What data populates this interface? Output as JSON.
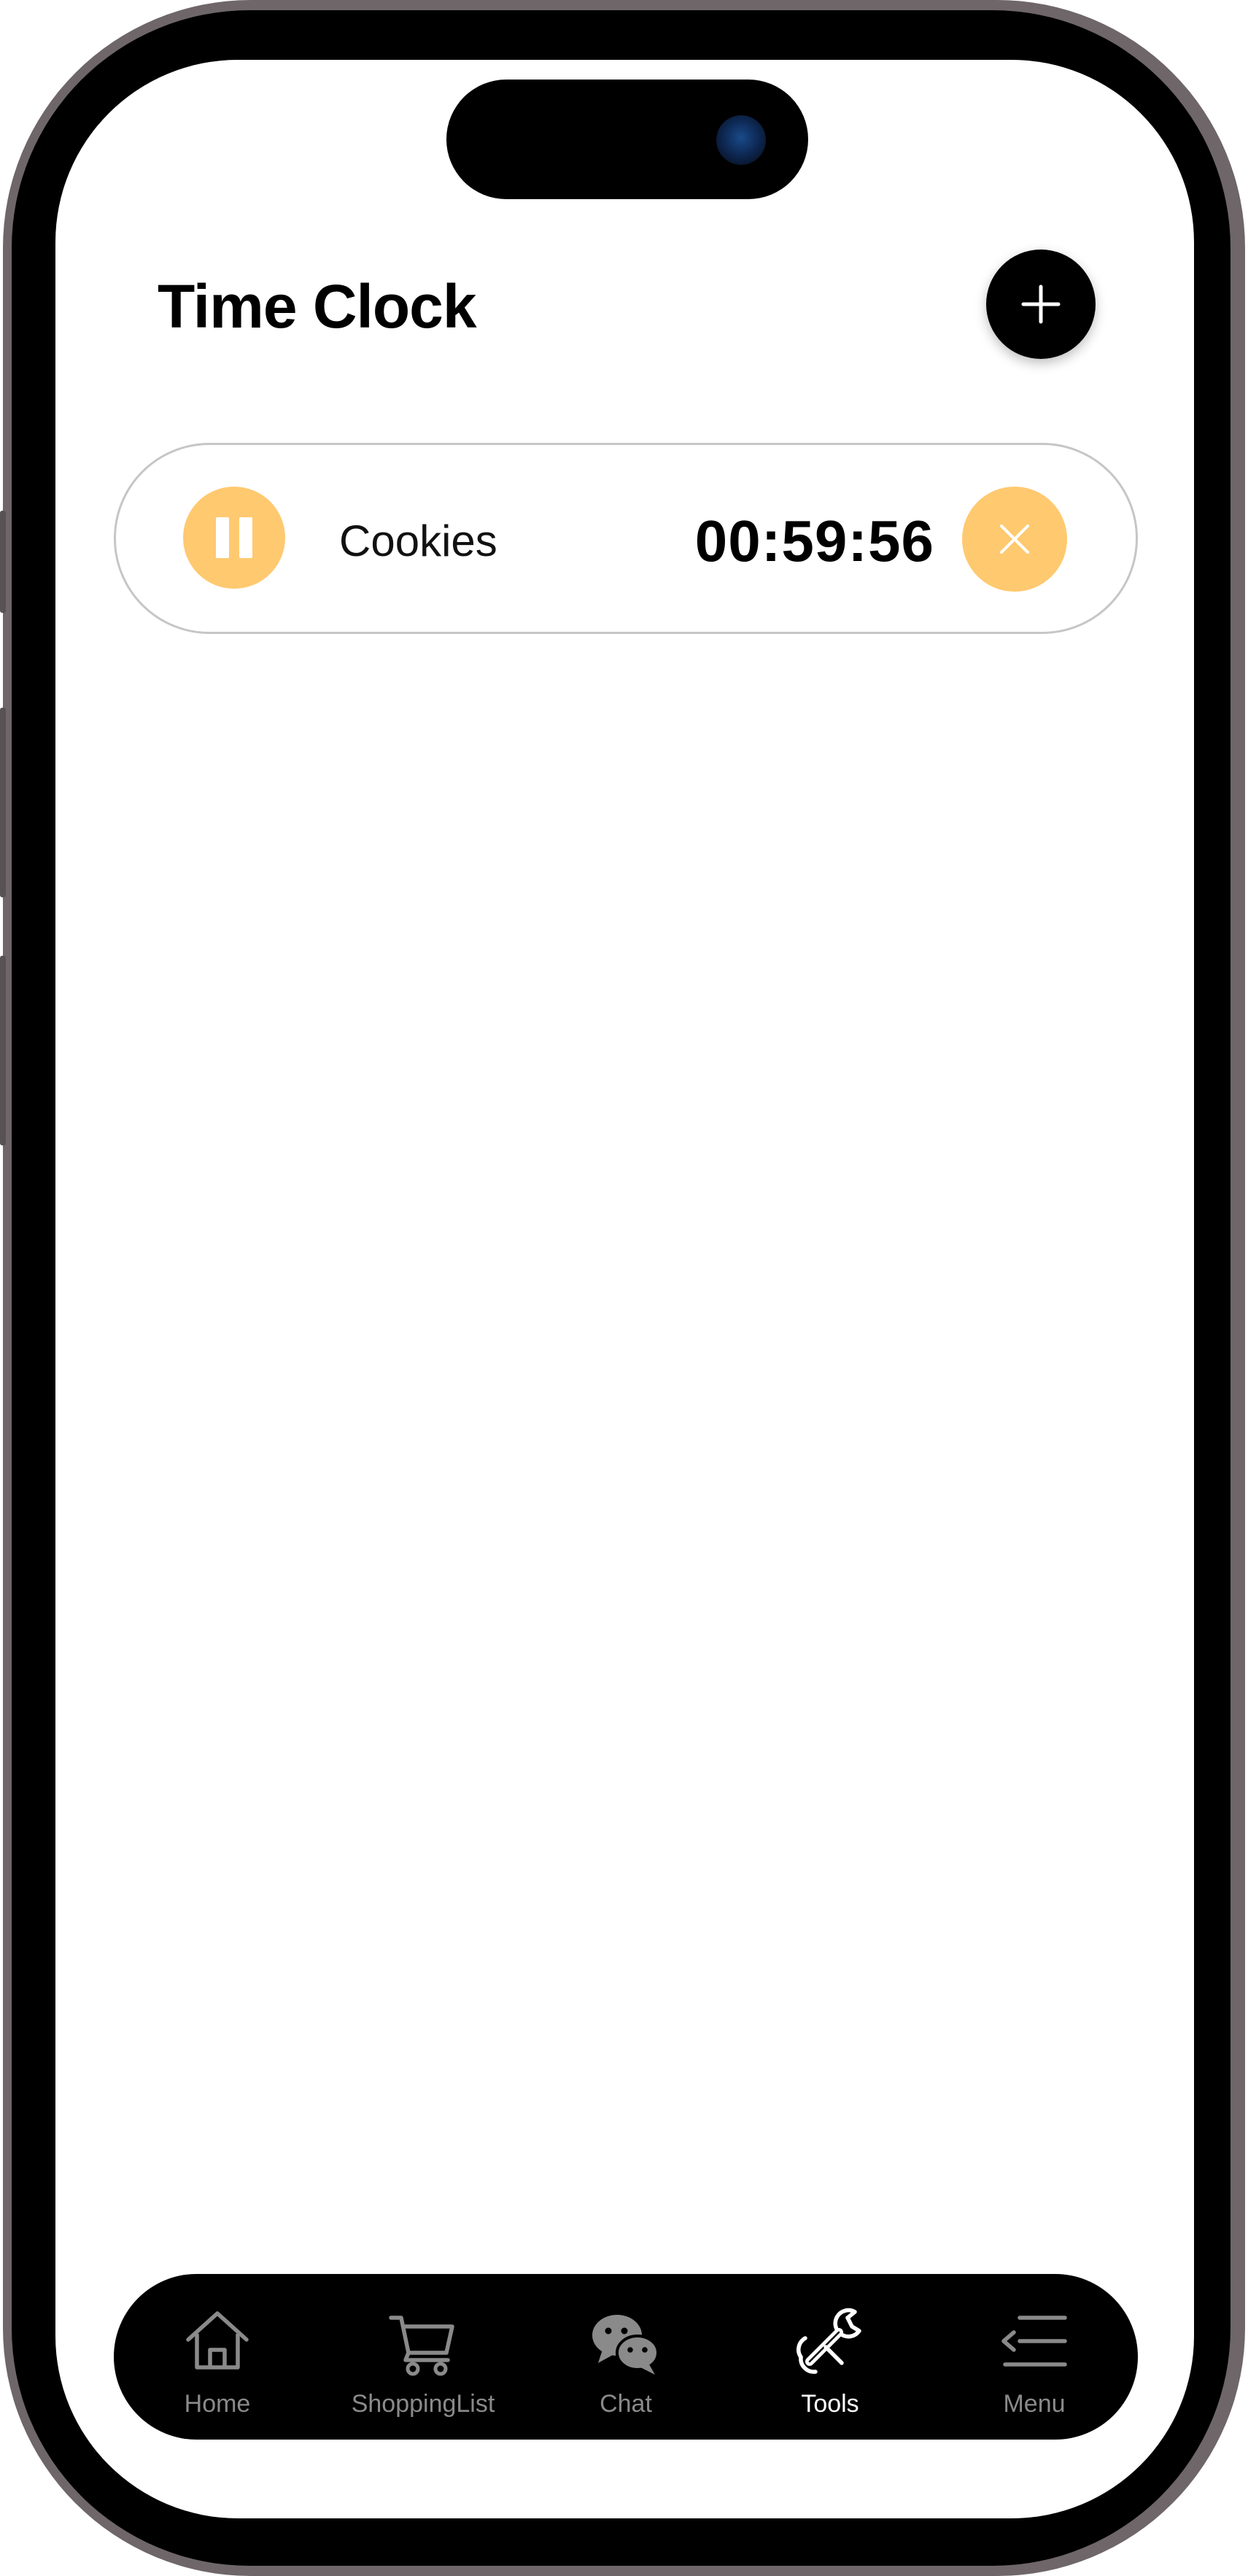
{
  "page": {
    "title": "Time Clock"
  },
  "icons": {
    "add": "plus-icon",
    "pause": "pause-icon",
    "cancel": "close-icon"
  },
  "timer": {
    "name": "Cookies",
    "time": "00:59:56"
  },
  "tabs": [
    {
      "label": "Home",
      "icon": "home-icon",
      "active": false
    },
    {
      "label": "ShoppingList",
      "icon": "cart-icon",
      "active": false
    },
    {
      "label": "Chat",
      "icon": "chat-icon",
      "active": false
    },
    {
      "label": "Tools",
      "icon": "tools-icon",
      "active": true
    },
    {
      "label": "Menu",
      "icon": "menu-icon",
      "active": false
    }
  ],
  "colors": {
    "accent": "#ffc970",
    "tab_bar_background": "#000000",
    "tab_active": "#ffffff",
    "tab_inactive": "#8a8a8a",
    "frame": "#6e6668"
  }
}
